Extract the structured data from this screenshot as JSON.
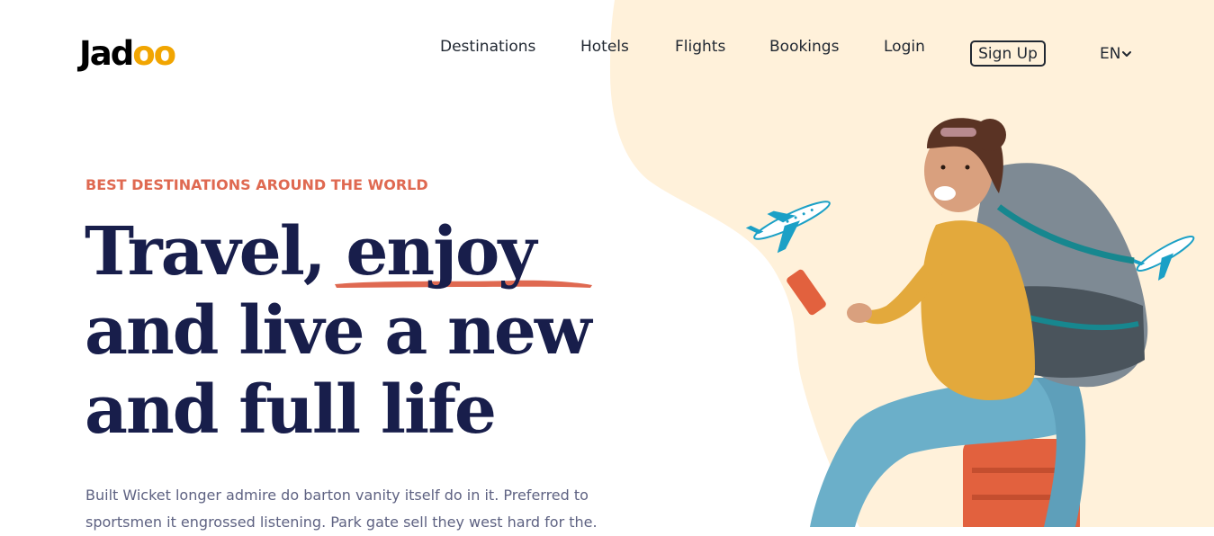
{
  "logo": {
    "prefix": "Jad",
    "o1": "o",
    "o2": "o"
  },
  "nav": {
    "links": [
      "Destinations",
      "Hotels",
      "Flights",
      "Bookings",
      "Login"
    ],
    "signup_label": "Sign Up",
    "language": "EN"
  },
  "hero": {
    "eyebrow": "BEST DESTINATIONS AROUND THE WORLD",
    "headline_line1_a": "Travel, ",
    "headline_line1_b": "enjoy",
    "headline_line2": "and live a new",
    "headline_line3": "and full life",
    "description": "Built Wicket longer admire do barton vanity itself do in it. Preferred to sportsmen it engrossed listening. Park gate sell they west hard for the."
  },
  "colors": {
    "accent": "#DF6951",
    "logo_accent": "#F1A501",
    "heading": "#181E4B",
    "body_text": "#5E6282",
    "blob": "#FFF1DA",
    "plane": "#1BA0C6"
  },
  "icons": [
    "chevron-down-icon",
    "airplane-icon",
    "traveler-illustration"
  ]
}
